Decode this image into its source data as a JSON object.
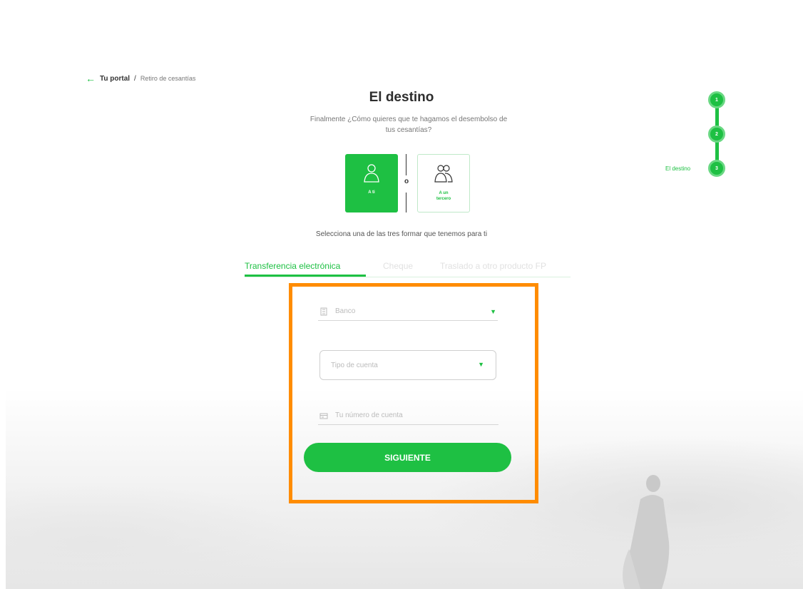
{
  "breadcrumb": {
    "home": "Tu portal",
    "separator": "/",
    "current": "Retiro de cesantías"
  },
  "header": {
    "title": "El destino",
    "subtitle_line1": "Finalmente ¿Cómo quieres que te hagamos el desembolso de",
    "subtitle_line2": "tus cesantías?"
  },
  "destination": {
    "option_me": {
      "label": "A ti",
      "selected": true
    },
    "separator": "o",
    "option_other": {
      "label_line1": "A un",
      "label_line2": "tercero",
      "selected": false
    }
  },
  "methods": {
    "instruction": "Selecciona una de las tres formar que tenemos para ti",
    "tabs": [
      {
        "label": "Transferencia electrónica",
        "active": true
      },
      {
        "label": "Cheque",
        "active": false
      },
      {
        "label": "Traslado a otro producto FP",
        "active": false
      }
    ]
  },
  "form": {
    "banco_placeholder": "Banco",
    "tipo_cuenta_placeholder": "Tipo de cuenta",
    "numero_cuenta_placeholder": "Tu número de cuenta",
    "submit_label": "SIGUIENTE"
  },
  "stepper": {
    "steps": [
      "1",
      "2",
      "3"
    ],
    "current_label": "El destino",
    "current_step": 3
  },
  "colors": {
    "brand_green": "#1ec043",
    "highlight_orange": "#ff8c00"
  },
  "icons": {
    "back": "arrow-left-icon",
    "person": "user-icon",
    "group": "users-icon",
    "bank": "bank-icon",
    "card": "card-icon",
    "chevron": "chevron-down-icon"
  }
}
